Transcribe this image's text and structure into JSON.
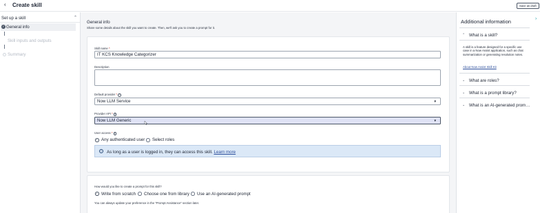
{
  "header": {
    "back_icon": "arrow-left-icon",
    "title": "Create skill",
    "save_draft_label": "Save as draft"
  },
  "sidebar": {
    "heading": "Set up a skill",
    "collapse_icon": "chevron-up-icon",
    "steps": [
      {
        "label": "General info",
        "state": "active"
      },
      {
        "label": "Skill inputs and outputs",
        "state": "pending"
      },
      {
        "label": "Summary",
        "state": "pending"
      }
    ]
  },
  "general_info": {
    "title": "General info",
    "subtitle": "Share some details about the skill you want to create. Then, we'll ask you to create a prompt for it.",
    "skill_name_label": "Skill name",
    "skill_name_value": "IT KCS Knowledge Categorizer",
    "description_label": "Description",
    "description_value": "",
    "default_provider_label": "Default provider",
    "default_provider_value": "Now LLM Service",
    "provider_api_label": "Provider API",
    "provider_api_value": "Now LLM Generic",
    "user_access_label": "User access",
    "user_access_options": [
      "Any authenticated user",
      "Select roles"
    ],
    "user_access_selected": "Any authenticated user",
    "notice_text": "As long as a user is logged in, they can access this skill.",
    "notice_link": "Learn more"
  },
  "prompt_section": {
    "question": "How would you like to create a prompt for this skill?",
    "options": [
      "Write from scratch",
      "Choose one from library",
      "Use an AI-generated prompt"
    ],
    "selected": "Write from scratch",
    "footnote": "You can always update your preference in the \"Prompt Assistance\" section later."
  },
  "right_panel": {
    "title": "Additional information",
    "items": [
      {
        "label": "What is a skill?",
        "expanded": true
      },
      {
        "label": "What are roles?",
        "expanded": false
      },
      {
        "label": "What is a prompt library?",
        "expanded": false
      },
      {
        "label": "What is an AI-generated prom…",
        "expanded": false
      }
    ],
    "skill_body": "A skill is a feature designed for a specific use case in a Now Assist application, such as chat summarization or generating resolution notes.",
    "skill_link": "About Now Assist Skill Kit"
  },
  "colors": {
    "accent": "#4a5565",
    "notice_bg": "#dbe8f7",
    "selected_field_bg": "#dfe2f5",
    "link": "#2b4d9b",
    "required": "#c42c1d"
  }
}
